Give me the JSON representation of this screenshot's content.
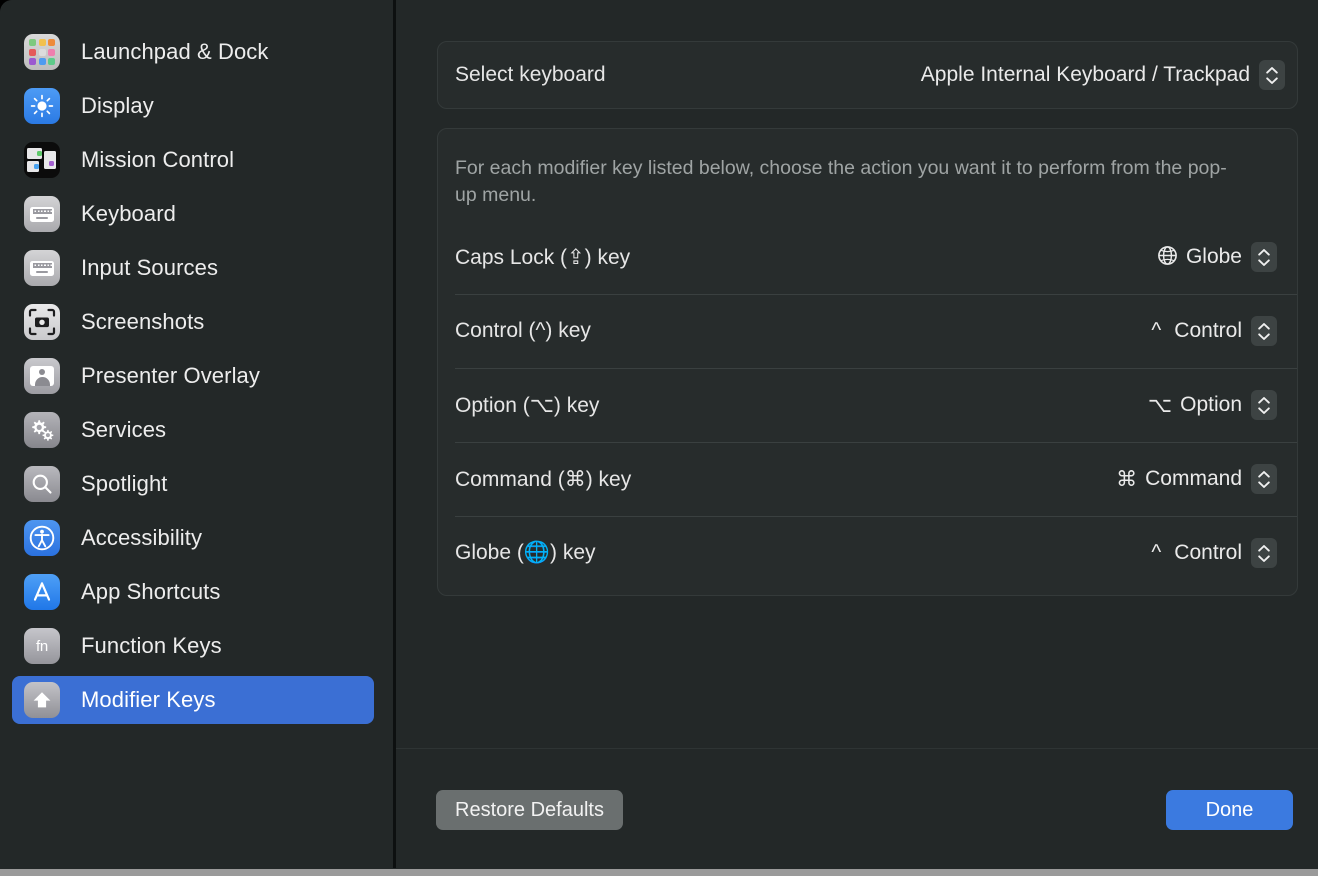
{
  "sidebar": {
    "items": [
      {
        "label": "Launchpad & Dock",
        "icon": "launchpad-icon",
        "selected": false
      },
      {
        "label": "Display",
        "icon": "display-icon",
        "selected": false
      },
      {
        "label": "Mission Control",
        "icon": "mission-control-icon",
        "selected": false
      },
      {
        "label": "Keyboard",
        "icon": "keyboard-icon",
        "selected": false
      },
      {
        "label": "Input Sources",
        "icon": "input-sources-icon",
        "selected": false
      },
      {
        "label": "Screenshots",
        "icon": "screenshots-icon",
        "selected": false
      },
      {
        "label": "Presenter Overlay",
        "icon": "presenter-overlay-icon",
        "selected": false
      },
      {
        "label": "Services",
        "icon": "services-icon",
        "selected": false
      },
      {
        "label": "Spotlight",
        "icon": "spotlight-icon",
        "selected": false
      },
      {
        "label": "Accessibility",
        "icon": "accessibility-icon",
        "selected": false
      },
      {
        "label": "App Shortcuts",
        "icon": "app-shortcuts-icon",
        "selected": false
      },
      {
        "label": "Function Keys",
        "icon": "fn-icon",
        "selected": false
      },
      {
        "label": "Modifier Keys",
        "icon": "modifier-keys-icon",
        "selected": true
      }
    ]
  },
  "main": {
    "keyboard_selector": {
      "label": "Select keyboard",
      "value": "Apple Internal Keyboard / Trackpad"
    },
    "description": "For each modifier key listed below, choose the action you want it to perform from the pop-up menu.",
    "modifier_rows": [
      {
        "label": "Caps Lock (⇪) key",
        "value_symbol": "ἱ0",
        "value": "Globe"
      },
      {
        "label": "Control (^) key",
        "value_symbol": "^",
        "value": "Control"
      },
      {
        "label": "Option (⌥) key",
        "value_symbol": "⌥",
        "value": "Option"
      },
      {
        "label": "Command (⌘) key",
        "value_symbol": "⌘",
        "value": "Command"
      },
      {
        "label": "Globe (🌐) key",
        "value_symbol": "^",
        "value": "Control"
      }
    ]
  },
  "footer": {
    "restore_label": "Restore Defaults",
    "done_label": "Done"
  },
  "colors": {
    "accent": "#3b7ae0",
    "selection": "#3b6fd4",
    "window_bg": "#232828",
    "groupbox_bg": "#272c2c",
    "secondary_text": "#9fa4a4"
  }
}
